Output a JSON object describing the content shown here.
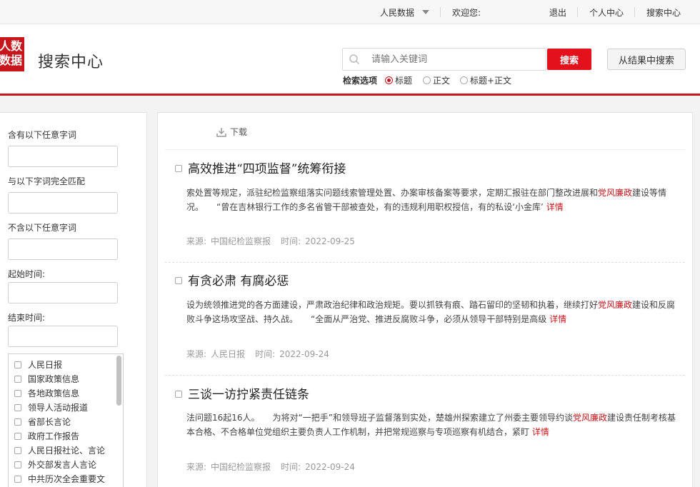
{
  "topbar": {
    "product": "人民数据",
    "welcome": "欢迎您:",
    "logout": "退出",
    "profile": "个人中心",
    "search_center": "搜索中心"
  },
  "header": {
    "logo_line1": "人数",
    "logo_line2": "数据",
    "title": "搜索中心",
    "search_placeholder": "请输入关键词",
    "search_button": "搜索",
    "search_within_button": "从结果中搜索",
    "options_label": "检索选项",
    "options": [
      {
        "label": "标题",
        "selected": true
      },
      {
        "label": "正文",
        "selected": false
      },
      {
        "label": "标题+正文",
        "selected": false
      }
    ]
  },
  "filters": {
    "any_words_label": "含有以下任意字词",
    "exact_match_label": "与以下字词完全匹配",
    "exclude_label": "不含以下任意字词",
    "start_time_label": "起始时间:",
    "end_time_label": "结束时间:",
    "sources": [
      "人民日报",
      "国家政策信息",
      "各地政策信息",
      "领导人活动报道",
      "省部长言论",
      "政府工作报告",
      "人民日报社论、言论",
      "外交部发言人言论",
      "中共历次全会重要文"
    ]
  },
  "toolbar": {
    "download": "下载"
  },
  "results": [
    {
      "title": "高效推进“四项监督”统筹衔接",
      "body_before": "索处置等规定，派驻纪检监察组落实问题线索管理处置、办案审核备案等要求，定期汇报驻在部门整改进展和",
      "highlight": "党风廉政",
      "body_after": "建设等情况。　　“曾在吉林银行工作的多名省管干部被查处，有的违规利用职权授信，有的私设‘小金库’",
      "more": "详情",
      "source_label": "来源:",
      "source": "中国纪检监察报",
      "time_label": "时间:",
      "date": "2022-09-25"
    },
    {
      "title": "有贪必肃 有腐必惩",
      "body_before": "设为统领推进党的各方面建设，严肃政治纪律和政治规矩。要以抓铁有痕、踏石留印的坚韧和执着，继续打好",
      "highlight": "党风廉政",
      "body_after": "建设和反腐败斗争这场攻坚战、持久战。　　“全面从严治党、推进反腐败斗争，必须从领导干部特别是高级",
      "more": "详情",
      "source_label": "来源:",
      "source": "人民日报",
      "time_label": "时间:",
      "date": "2022-09-24"
    },
    {
      "title": "三谈一访拧紧责任链条",
      "body_before": "法问题16起16人。　　为将对“一把手”和领导班子监督落到实处，楚雄州探索建立了州委主要领导约谈",
      "highlight": "党风廉政",
      "body_after": "建设责任制考核基本合格、不合格单位党组织主要负责人工作机制，并把常规巡察与专项巡察有机结合，紧盯",
      "more": "详情",
      "source_label": "来源:",
      "source": "中国纪检监察报",
      "time_label": "时间:",
      "date": "2022-09-24"
    }
  ],
  "colors": {
    "brand_red": "#c8161d",
    "button_red": "#e3111b"
  }
}
